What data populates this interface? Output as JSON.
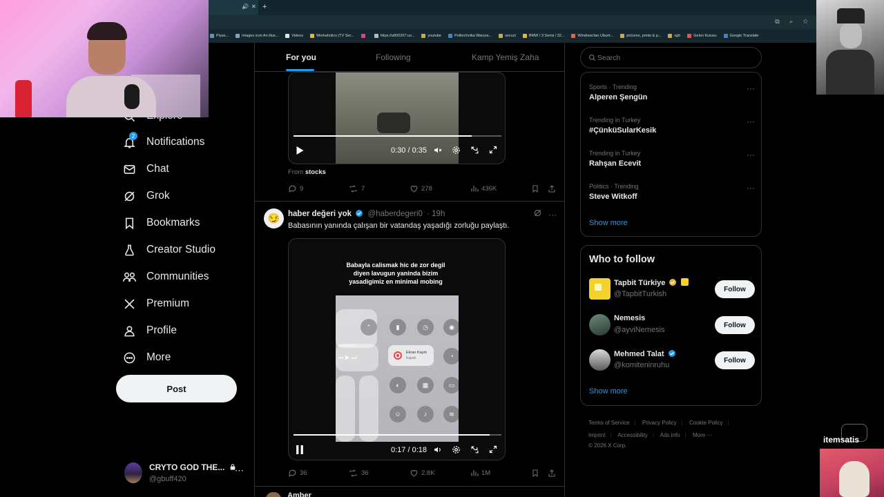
{
  "browser": {
    "bookmarks": [
      {
        "label": "Piyas...",
        "color": "#6d8fb5"
      },
      {
        "label": "Images icon An illus...",
        "color": "#8aa2b8"
      },
      {
        "label": "Videos",
        "color": "#e0e0e0"
      },
      {
        "label": "Workaholics (TV Ser...",
        "color": "#e2b53e"
      },
      {
        "label": "",
        "color": "#d8418f"
      },
      {
        "label": "https://a800207.us...",
        "color": "#b0bec5"
      },
      {
        "label": "youtube",
        "color": "#c9a94e"
      },
      {
        "label": "Politechnika Warsza...",
        "color": "#4a7fc1"
      },
      {
        "label": "secuzi",
        "color": "#c9a94e"
      },
      {
        "label": "BMW / 3 Serisi / 32...",
        "color": "#e2b53e"
      },
      {
        "label": "Windows'tan Ubunt...",
        "color": "#e0634a"
      },
      {
        "label": "pictures, prints & p...",
        "color": "#c9a94e"
      },
      {
        "label": "sgh",
        "color": "#c9a94e"
      },
      {
        "label": "Gelen Kutusu",
        "color": "#e5544b"
      },
      {
        "label": "Google Translate",
        "color": "#4a7fc1"
      }
    ]
  },
  "nav": {
    "explore_label": "Explore",
    "notification_count": "2",
    "items": [
      {
        "label": "Notifications"
      },
      {
        "label": "Chat"
      },
      {
        "label": "Grok"
      },
      {
        "label": "Bookmarks"
      },
      {
        "label": "Creator Studio"
      },
      {
        "label": "Communities"
      },
      {
        "label": "Premium"
      },
      {
        "label": "Profile"
      },
      {
        "label": "More"
      }
    ],
    "post_label": "Post"
  },
  "account": {
    "name": "CRYTO GOD THE...",
    "handle": "@gbuff420",
    "more": "⋯"
  },
  "timeline": {
    "tabs": [
      "For you",
      "Following",
      "Kamp Yemiş Zaha"
    ],
    "tweet1": {
      "video": {
        "time": "0:30 / 0:35",
        "progress": 0.857
      },
      "from_prefix": "From",
      "from_source": "stocks",
      "replies": "9",
      "reposts": "7",
      "likes": "278",
      "views": "436K"
    },
    "tweet2": {
      "avatar_emoji": "😏",
      "name": "haber değeri yok",
      "handle": "@haberdegeri0",
      "time": "19h",
      "text": "Babasının yanında çalışan bir vatandaş yaşadığı zorluğu paylaştı.",
      "video_caption": "Babayla calismak hic de zor degil diyen lavugun yaninda bizim yasadigimiz en minimal mobing",
      "cc_record_title": "Ekran Kaydı",
      "cc_record_sub": "Kapalı",
      "cc_media_label": "Oynatılmıyor",
      "video": {
        "time": "0:17 / 0:18",
        "progress": 0.944
      },
      "replies": "36",
      "reposts": "36",
      "likes": "2.8K",
      "views": "1M"
    },
    "tweet3_peek": "Amber"
  },
  "sidebar": {
    "search_placeholder": "Search",
    "trends": [
      {
        "meta": "Sports · Trending",
        "title": "Alperen Şengün"
      },
      {
        "meta": "Trending in Turkey",
        "title": "#ÇünküSularKesik"
      },
      {
        "meta": "Trending in Turkey",
        "title": "Rahşan Ecevit"
      },
      {
        "meta": "Politics · Trending",
        "title": "Steve Witkoff"
      }
    ],
    "trends_show_more": "Show more",
    "who_to_follow_title": "Who to follow",
    "who_to_follow": [
      {
        "name": "Tapbit Türkiye",
        "handle": "@TapbitTurkish",
        "follow": "Follow"
      },
      {
        "name": "Nemesis",
        "handle": "@ayviNemesis",
        "follow": "Follow"
      },
      {
        "name": "Mehmed Talat",
        "handle": "@komiteninruhu",
        "follow": "Follow"
      }
    ],
    "wtf_show_more": "Show more",
    "footer": {
      "links": [
        "Terms of Service",
        "Privacy Policy",
        "Cookie Policy",
        "Imprint",
        "Accessibility",
        "Ads info",
        "More ···"
      ],
      "copyright": "© 2026 X Corp."
    }
  },
  "overlay": {
    "brand_logo": "itemsatis"
  },
  "colors": {
    "accent": "#1d9bf0",
    "background": "#000000",
    "border": "#2f3336",
    "muted_text": "#71767b"
  }
}
